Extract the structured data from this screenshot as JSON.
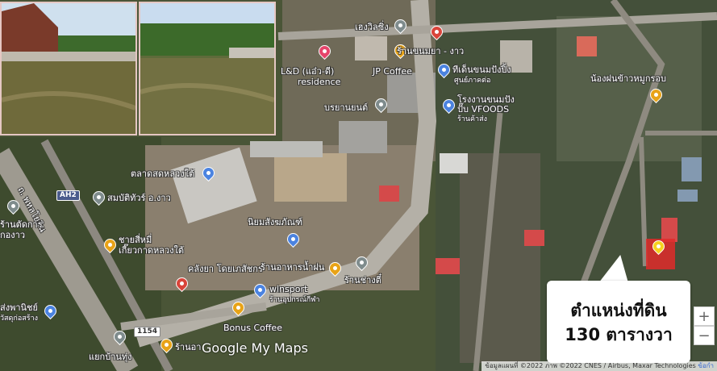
{
  "labels": {
    "heng_racing": "เฮงวิลซิ่ง",
    "khanom_store": "ร้านขนมยา - งาว",
    "ld_residence_1": "L&D (แอ๋ว-ดี)",
    "ld_residence_2": "residence",
    "jp_coffee": "JP Coffee",
    "bakery_1": "ทีเด็นขนมปังปิ้ง",
    "bakery_2": "ศูนย์ภาคต่อ",
    "nong_rice_1": "น้องฝนข้าวหมูกรอบ",
    "boonyanyon": "บรยานยนต์",
    "vfoods_1": "โรงงานขนมปัง",
    "vfoods_2": "ปั๊บ VFOODS",
    "vfoods_3": "ร้านค้าส่ง",
    "fresh_market": "ตลาดสดหลวงใต้",
    "tour": "สมบัติทัวร์ อ.งาว",
    "road_name": "ถ. พหลโยธิน",
    "ah2": "AH2",
    "shop_left_1": "ร้านตัดการ",
    "shop_left_2": "กองาว",
    "noodle_1": "ชายสี่หมี่",
    "noodle_2": "เกี๊ยวกาดหลวงใต้",
    "niyom": "นิยมสังฆภัณฑ์",
    "klang_ya": "คลังยา โดยเภสัชกร",
    "restaurant": "ร้านอาหารน้ำฝน",
    "chang_tio": "ร้านช่างตี๋",
    "winsport_1": "winsport",
    "winsport_2": "ร้านอุปกรณ์กีฬา",
    "songphanit_1": "ส่งพานิชย์",
    "songphanit_2": "วัสดุก่อสร้าง",
    "bonus_coffee": "Bonus Coffee",
    "route_1154": "1154",
    "yaek_banthung": "แยกบ้านทุ่ง",
    "rhan_a": "ร้านอา"
  },
  "callout": {
    "line1": "ตำแหน่งที่ดิน",
    "line2": "130 ตารางวา"
  },
  "zoom": {
    "in": "+",
    "out": "−"
  },
  "watermark": "Google My Maps",
  "attribution": "ข้อมูลแผนที่ ©2022 ภาพ ©2022 CNES / Airbus, Maxar Technologies",
  "attribution_extra": "ข้อกำ",
  "colors": {
    "pin_yellow": "#f6d11f",
    "pin_orange": "#e8a317",
    "pin_pink": "#e6456b",
    "pin_blue": "#4b83e0",
    "pin_gray": "#7f8c8d",
    "pin_red": "#d9443a",
    "plot_red": "#e02a2a"
  }
}
